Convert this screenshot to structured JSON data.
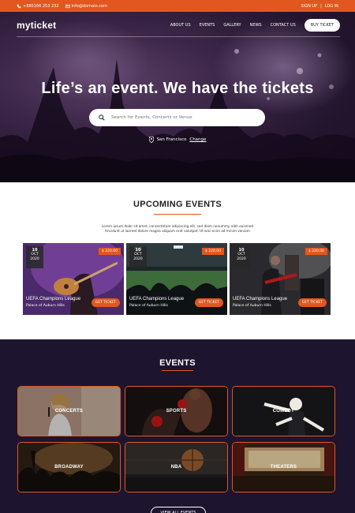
{
  "topbar": {
    "phone": "+880166 253 232",
    "email": "info@domain.com",
    "signup": "SIGN UP",
    "separator": "|",
    "login": "LOG IN"
  },
  "nav": {
    "logo": "myticket",
    "items": [
      "ABOUT US",
      "EVENTS",
      "GALLERY",
      "NEWS",
      "CONTACT US"
    ],
    "buy_ticket": "BUY TICKET"
  },
  "hero": {
    "title": "Life’s an event. We have the tickets",
    "search_placeholder": "Search for Events, Concerts or Venue",
    "location": "San Francisco",
    "change": "Change"
  },
  "upcoming": {
    "title": "UPCOMING EVENTS",
    "description": "Lorem ipsum dolor sit amet, consectetuer adipiscing elit, sed diam nonummy nibh euismod tincidunt ut laoreet dolore magna aliquam erat volutpat. Ut wisi enim ad minim veniam",
    "cards": [
      {
        "day": "10",
        "month": "OCT",
        "year": "2020",
        "price": "$ 220.00",
        "title": "UEFA Champions League",
        "venue": "Palace of Auburn Hills",
        "button": "GET TICKET"
      },
      {
        "day": "10",
        "month": "OCT",
        "year": "2020",
        "price": "$ 220.00",
        "title": "UEFA Champions League",
        "venue": "Palace of Auburn Hills",
        "button": "GET TICKET"
      },
      {
        "day": "10",
        "month": "OCT",
        "year": "2020",
        "price": "$ 220.00",
        "title": "UEFA Champions League",
        "venue": "Palace of Auburn Hills",
        "button": "GET TICKET"
      }
    ]
  },
  "events": {
    "title": "EVENTS",
    "tiles": [
      "CONCERTS",
      "SPORTS",
      "COMEDY",
      "BROADWAY",
      "NBA",
      "THEATERS"
    ],
    "view_all": "VIEW ALL EVENTS"
  },
  "colors": {
    "accent": "#e2571f",
    "dark": "#1d1530",
    "hero": "#2b1b38"
  }
}
